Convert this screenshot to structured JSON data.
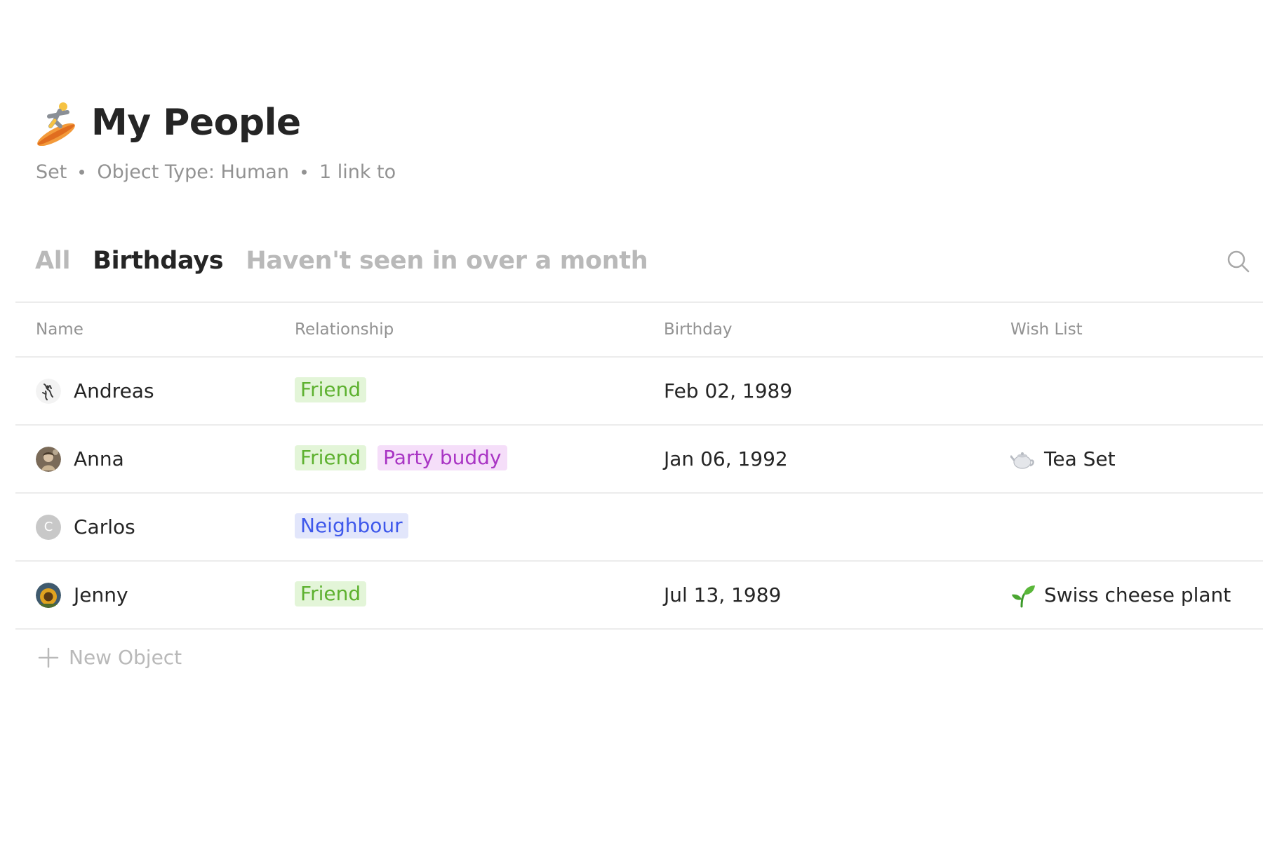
{
  "header": {
    "title_emoji": "surfer-icon",
    "title": "My People",
    "meta": [
      "Set",
      "Object Type: Human",
      "1 link to"
    ]
  },
  "tabs": [
    {
      "label": "All",
      "active": false
    },
    {
      "label": "Birthdays",
      "active": true
    },
    {
      "label": "Haven't seen in over a month",
      "active": false
    }
  ],
  "table": {
    "columns": [
      "Name",
      "Relationship",
      "Birthday",
      "Wish List"
    ],
    "rows": [
      {
        "name": "Andreas",
        "avatar": "sketch-avatar",
        "relationships": [
          {
            "label": "Friend",
            "color": "#5db12f",
            "bg": "#e3f5d8"
          }
        ],
        "birthday": "Feb 02, 1989",
        "wish": null
      },
      {
        "name": "Anna",
        "avatar": "photo-avatar",
        "relationships": [
          {
            "label": "Friend",
            "color": "#5db12f",
            "bg": "#e3f5d8"
          },
          {
            "label": "Party buddy",
            "color": "#a935c4",
            "bg": "#f5def9"
          }
        ],
        "birthday": "Jan 06, 1992",
        "wish": {
          "icon": "teapot-icon",
          "label": "Tea Set"
        }
      },
      {
        "name": "Carlos",
        "avatar": "letter-avatar",
        "avatar_letter": "C",
        "relationships": [
          {
            "label": "Neighbour",
            "color": "#3e58eb",
            "bg": "#e2e6fb"
          }
        ],
        "birthday": "",
        "wish": null
      },
      {
        "name": "Jenny",
        "avatar": "sunflower-avatar",
        "relationships": [
          {
            "label": "Friend",
            "color": "#5db12f",
            "bg": "#e3f5d8"
          }
        ],
        "birthday": "Jul 13, 1989",
        "wish": {
          "icon": "seedling-icon",
          "label": "Swiss cheese plant"
        }
      }
    ]
  },
  "new_object_label": "New Object"
}
